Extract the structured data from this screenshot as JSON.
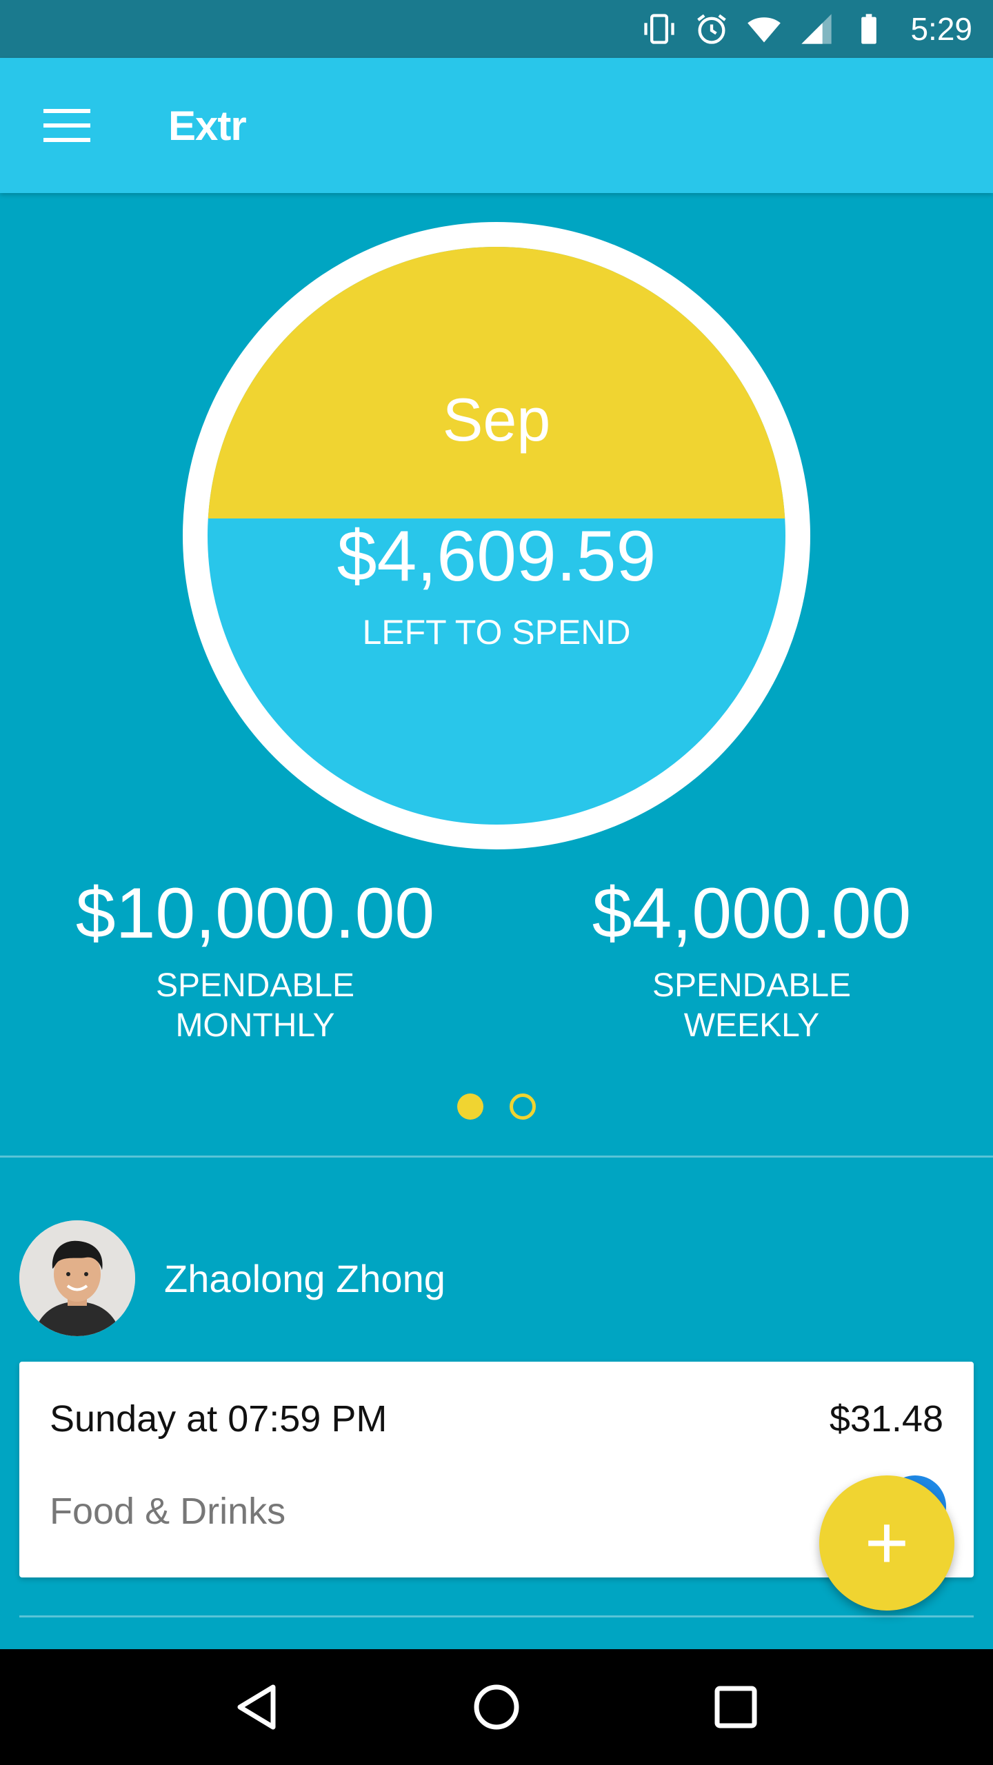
{
  "status_bar": {
    "time": "5:29",
    "icons": [
      "vibrate-icon",
      "alarm-icon",
      "wifi-icon",
      "signal-icon",
      "battery-icon"
    ]
  },
  "app_bar": {
    "title": "Extr",
    "menu_icon": "hamburger-menu-icon"
  },
  "budget": {
    "month": "Sep",
    "amount_left": "$4,609.59",
    "amount_left_label": "LEFT TO SPEND",
    "fill_fraction": 0.47
  },
  "stats": {
    "monthly": {
      "amount": "$10,000.00",
      "label_line1": "SPENDABLE",
      "label_line2": "MONTHLY"
    },
    "weekly": {
      "amount": "$4,000.00",
      "label_line1": "SPENDABLE",
      "label_line2": "WEEKLY"
    }
  },
  "pager": {
    "active_index": 0,
    "count": 2
  },
  "person": {
    "name": "Zhaolong Zhong"
  },
  "transaction": {
    "date": "Sunday at 07:59 PM",
    "amount": "$31.48",
    "category": "Food & Drinks"
  },
  "fab": {
    "label": "+"
  },
  "nav": {
    "icons": [
      "back-icon",
      "home-icon",
      "recents-icon"
    ]
  },
  "colors": {
    "background": "#00A5C2",
    "app_bar": "#29C6EA",
    "status_bar": "#1A7A8E",
    "accent_yellow": "#F0D431",
    "circle_blue": "#29C6EA"
  }
}
